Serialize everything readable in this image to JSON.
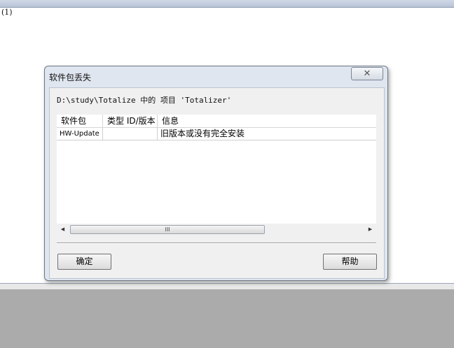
{
  "document": {
    "marker": "(1)"
  },
  "dialog": {
    "title": "软件包丢失",
    "close_glyph": "✕",
    "path_text": "D:\\study\\Totalize 中的 项目 'Totalizer'",
    "table": {
      "headers": [
        "软件包",
        "类型 ID/版本",
        "信息"
      ],
      "rows": [
        [
          "HW-Update",
          "",
          "旧版本或没有完全安装"
        ]
      ]
    },
    "scrollbar": {
      "left_arrow": "◀",
      "right_arrow": "▶",
      "grip": "III"
    },
    "buttons": {
      "ok": "确定",
      "help": "帮助"
    }
  }
}
